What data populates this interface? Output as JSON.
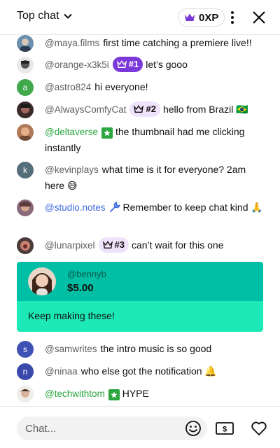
{
  "header": {
    "title": "Top chat",
    "xp_label": "0XP",
    "xp_color": "#7b38d8"
  },
  "messages": [
    {
      "username": "@maya.films",
      "text": "first time catching a premiere live!!"
    },
    {
      "username": "@orange-x3k5i",
      "badge": "#1",
      "text": "let’s gooo"
    },
    {
      "username": "@astro824",
      "avatar_letter": "a",
      "text": "hi everyone!"
    },
    {
      "username": "@AlwaysComfyCat",
      "badge": "#2",
      "text": "hello from Brazil 🇧🇷"
    },
    {
      "username": "@deltaverse",
      "text": "the thumbnail had me clicking instantly"
    },
    {
      "username": "@kevinplays",
      "avatar_letter": "k",
      "text": "what time is it for everyone? 2am here 😅"
    },
    {
      "username": "@studio.notes",
      "text": "Remember to keep chat kind 🙏"
    },
    {
      "username": "@lunarpixel",
      "badge": "#3",
      "text": "can’t wait for this one"
    },
    {
      "username": "@samwrites",
      "avatar_letter": "s",
      "text": "the intro music is so good"
    },
    {
      "username": "@ninaa",
      "avatar_letter": "n",
      "text": "who else got the notification 🔔"
    },
    {
      "username": "@techwithtom",
      "text": "HYPE"
    }
  ],
  "superchat": {
    "username": "@bennyb",
    "amount": "$5.00",
    "message": "Keep making these!",
    "header_color": "#00bfa5",
    "body_color": "#1de9b6"
  },
  "footer": {
    "placeholder": "Chat..."
  }
}
